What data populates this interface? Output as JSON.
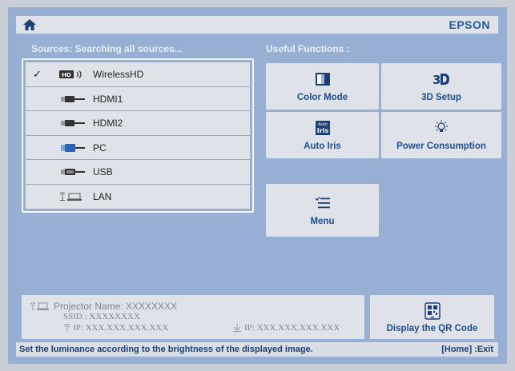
{
  "header": {
    "brand": "EPSON",
    "home_icon": "home-icon"
  },
  "sources": {
    "heading": "Sources: Searching all sources...",
    "items": [
      {
        "label": "WirelessHD",
        "icon": "wirelesshd-icon",
        "selected": true
      },
      {
        "label": "HDMI1",
        "icon": "hdmi-icon",
        "selected": false
      },
      {
        "label": "HDMI2",
        "icon": "hdmi-icon",
        "selected": false
      },
      {
        "label": "PC",
        "icon": "pc-icon",
        "selected": false
      },
      {
        "label": "USB",
        "icon": "usb-icon",
        "selected": false
      },
      {
        "label": "LAN",
        "icon": "lan-icon",
        "selected": false
      }
    ],
    "check_glyph": "✓"
  },
  "functions": {
    "heading": "Useful Functions :",
    "items": [
      {
        "label": "Color Mode",
        "icon": "color-mode-icon"
      },
      {
        "label": "3D Setup",
        "icon": "3d-icon"
      },
      {
        "label": "Auto Iris",
        "icon": "auto-iris-icon"
      },
      {
        "label": "Power Consumption",
        "icon": "power-consumption-icon"
      },
      {
        "label": "Menu",
        "icon": "menu-icon"
      }
    ]
  },
  "network_info": {
    "projector_name": "Projector Name:  XXXXXXXX",
    "ssid": "SSID :  XXXXXXXX",
    "wireless_ip": "IP:  XXX.XXX.XXX.XXX",
    "wired_ip": "IP:  XXX.XXX.XXX.XXX"
  },
  "qr": {
    "label": "Display the QR Code",
    "icon": "qr-code-icon"
  },
  "status": {
    "message": "Set the luminance according to the brightness of the displayed image.",
    "exit": "[Home] :Exit"
  },
  "colors": {
    "screen_bg": "#96afd2",
    "panel_bg": "#dfe2e8",
    "accent_text": "#1d4e91",
    "brand": "#1a5ba8"
  }
}
